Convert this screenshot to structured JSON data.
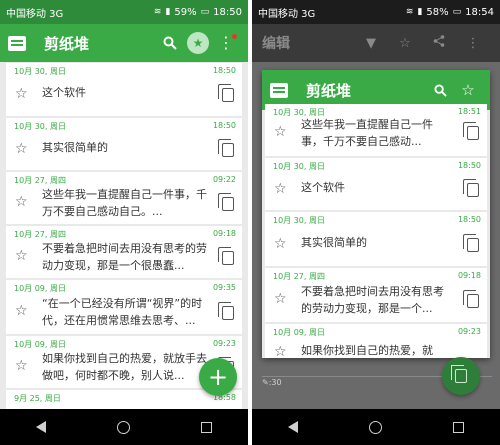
{
  "left_phone": {
    "status": {
      "carrier": "中国移动 3G",
      "battery": "59%",
      "time": "18:50"
    },
    "app_title": "剪纸堆",
    "clips": [
      {
        "date": "10月 30, 周日",
        "time": "18:50",
        "text": "这个软件"
      },
      {
        "date": "10月 30, 周日",
        "time": "18:50",
        "text": "其实很简单的"
      },
      {
        "date": "10月 27, 周四",
        "time": "09:22",
        "text": "这些年我一直提醒自己一件事，千万不要自己感动自己。..."
      },
      {
        "date": "10月 27, 周四",
        "time": "09:18",
        "text": "不要着急把时间去用没有思考的劳动力变现，那是一个很愚蠢..."
      },
      {
        "date": "10月 09, 周日",
        "time": "09:35",
        "text": "“在一个已经没有所谓“视界”的时代，还在用惯常思维去思考、..."
      },
      {
        "date": "10月 09, 周日",
        "time": "09:23",
        "text": "如果你找到自己的热爱，就放手去做吧，何时都不晚，别人说..."
      },
      {
        "date": "9月 25, 周日",
        "time": "18:58",
        "text": ""
      }
    ],
    "fab_label": "+"
  },
  "right_phone": {
    "status": {
      "carrier": "中国移动 3G",
      "battery": "58%",
      "time": "18:54"
    },
    "edit_title": "编辑",
    "counter": ":30",
    "popup": {
      "app_title": "剪纸堆",
      "clips": [
        {
          "date": "10月 30, 周日",
          "time": "18:51",
          "text": "这些年我一直提醒自己一件事，千万不要自己感动..."
        },
        {
          "date": "10月 30, 周日",
          "time": "18:50",
          "text": "这个软件"
        },
        {
          "date": "10月 30, 周日",
          "time": "18:50",
          "text": "其实很简单的"
        },
        {
          "date": "10月 27, 周四",
          "time": "09:18",
          "text": "不要着急把时间去用没有思考的劳动力变现，那是一个..."
        },
        {
          "date": "10月 09, 周日",
          "time": "09:23",
          "text": "如果你找到自己的热爱，就"
        }
      ]
    }
  },
  "colors": {
    "primary": "#3aaa46",
    "status_bar": "#2e8b3a",
    "dimmed": "#5a5a5a"
  }
}
